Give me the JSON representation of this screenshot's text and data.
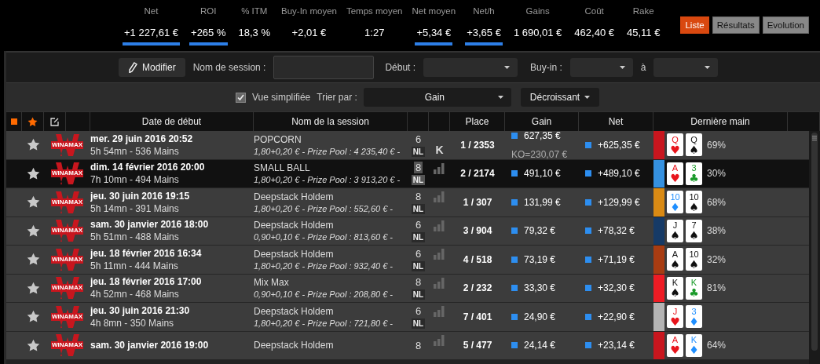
{
  "stats": [
    {
      "label": "Net",
      "value": "+1 227,61 €",
      "highlighted": true
    },
    {
      "label": "ROI",
      "value": "+265 %",
      "highlighted": true
    },
    {
      "label": "% ITM",
      "value": "18,3 %",
      "highlighted": false
    },
    {
      "label": "Buy-In moyen",
      "value": "+2,01 €",
      "highlighted": false
    },
    {
      "label": "Temps moyen",
      "value": "1:27",
      "highlighted": false
    },
    {
      "label": "Net moyen",
      "value": "+5,34 €",
      "highlighted": true
    },
    {
      "label": "Net/h",
      "value": "+3,65 €",
      "highlighted": true
    },
    {
      "label": "Gains",
      "value": "1 690,01 €",
      "highlighted": false
    },
    {
      "label": "Coût",
      "value": "462,40 €",
      "highlighted": false
    },
    {
      "label": "Rake",
      "value": "45,11 €",
      "highlighted": false
    }
  ],
  "views": [
    {
      "label": "Liste",
      "selected": true
    },
    {
      "label": "Résultats",
      "selected": false
    },
    {
      "label": "Evolution",
      "selected": false
    }
  ],
  "filters": {
    "edit_button": "Modifier",
    "session_label": "Nom de session :",
    "start_label": "Début :",
    "buyin_label": "Buy-in :",
    "to_label": "à"
  },
  "sort": {
    "simplified_label": "Vue simplifiée",
    "simplified_checked": true,
    "sort_label": "Trier par :",
    "sort_value": "Gain",
    "order": "Décroissant"
  },
  "table": {
    "columns": [
      "Date de début",
      "Nom de la session",
      "Place",
      "Gain",
      "Net",
      "Dernière main"
    ],
    "rows": [
      {
        "selected": false,
        "room": "WINAMAX",
        "date": "mer. 29 juin 2016 20:52",
        "duration": "5h 54mn - 536 Mains",
        "name": "POPCORN",
        "details": "1,80+0,20 € - Prize Pool : 4 235,40 € -",
        "seats": "6",
        "game": "NL",
        "kind": "knockout",
        "level_text": "K",
        "place": "1 / 2353",
        "gain": "627,35 €",
        "gain_note": "KO=230,07 €",
        "net": "+625,35 €",
        "color": "#c8161e",
        "cards": [
          {
            "rank": "Q",
            "suit": "♥",
            "color": "#e8141c"
          },
          {
            "rank": "Q",
            "suit": "♠",
            "color": "#111111"
          }
        ],
        "pct": "69%"
      },
      {
        "selected": true,
        "room": "WINAMAX",
        "date": "dim. 14 février 2016 20:00",
        "duration": "7h 10mn - 494 Mains",
        "name": "SMALL BALL",
        "details": "1,80+0,20 € - Prize Pool : 3 913,20 € -",
        "seats": "8",
        "game": "NL",
        "kind": "bars",
        "place": "2 / 2174",
        "gain": "491,10 €",
        "net": "+489,10 €",
        "color": "#3591e0",
        "cards": [
          {
            "rank": "A",
            "suit": "♥",
            "color": "#e8141c"
          },
          {
            "rank": "3",
            "suit": "♣",
            "color": "#1a9a2a"
          }
        ],
        "pct": "30%"
      },
      {
        "selected": false,
        "room": "WINAMAX",
        "date": "jeu. 30 juin 2016 19:15",
        "duration": "5h 14mn - 391 Mains",
        "name": "Deepstack Holdem",
        "details": "1,80+0,20 € - Prize Pool : 552,60 € -",
        "seats": "8",
        "game": "NL",
        "kind": "bars",
        "place": "1 / 307",
        "gain": "131,99 €",
        "net": "+129,99 €",
        "color": "#d98a14",
        "cards": [
          {
            "rank": "10",
            "suit": "♦",
            "color": "#1f8fff"
          },
          {
            "rank": "10",
            "suit": "♠",
            "color": "#111111"
          }
        ],
        "pct": "68%"
      },
      {
        "selected": false,
        "room": "WINAMAX",
        "date": "sam. 30 janvier 2016 18:00",
        "duration": "5h 51mn - 488 Mains",
        "name": "Deepstack Holdem",
        "details": "0,90+0,10 € - Prize Pool : 813,60 € -",
        "seats": "6",
        "game": "NL",
        "kind": "bars",
        "place": "3 / 904",
        "gain": "79,32 €",
        "net": "+78,32 €",
        "color": "#163a66",
        "cards": [
          {
            "rank": "J",
            "suit": "♠",
            "color": "#111111"
          },
          {
            "rank": "7",
            "suit": "♠",
            "color": "#111111"
          }
        ],
        "pct": "38%"
      },
      {
        "selected": false,
        "room": "WINAMAX",
        "date": "jeu. 18 février 2016 16:34",
        "duration": "5h 11mn - 444 Mains",
        "name": "Deepstack Holdem",
        "details": "1,80+0,20 € - Prize Pool : 932,40 € -",
        "seats": "6",
        "game": "NL",
        "kind": "bars",
        "place": "4 / 518",
        "gain": "73,19 €",
        "net": "+71,19 €",
        "color": "#a83c12",
        "cards": [
          {
            "rank": "A",
            "suit": "♠",
            "color": "#111111"
          },
          {
            "rank": "10",
            "suit": "♠",
            "color": "#111111"
          }
        ],
        "pct": "32%"
      },
      {
        "selected": false,
        "room": "WINAMAX",
        "date": "jeu. 18 février 2016 17:00",
        "duration": "4h 52mn - 468 Mains",
        "name": "Mix Max",
        "details": "0,90+0,10 € - Prize Pool : 208,80 € -",
        "seats": "8",
        "game": "NL",
        "kind": "bars",
        "place": "2 / 232",
        "gain": "33,30 €",
        "net": "+32,30 €",
        "color": "#ee1c24",
        "cards": [
          {
            "rank": "K",
            "suit": "♠",
            "color": "#111111"
          },
          {
            "rank": "K",
            "suit": "♣",
            "color": "#1a9a2a"
          }
        ],
        "pct": "81%"
      },
      {
        "selected": false,
        "room": "WINAMAX",
        "date": "jeu. 30 juin 2016 21:30",
        "duration": "4h 8mn - 350 Mains",
        "name": "Deepstack Holdem",
        "details": "1,80+0,20 € - Prize Pool : 721,80 € -",
        "seats": "6",
        "game": "NL",
        "kind": "bars",
        "place": "7 / 401",
        "gain": "24,90 €",
        "net": "+22,90 €",
        "color": "#b4b4b4",
        "cards": [
          {
            "rank": "J",
            "suit": "♥",
            "color": "#e8141c"
          },
          {
            "rank": "3",
            "suit": "♦",
            "color": "#1f8fff"
          }
        ]
      },
      {
        "selected": false,
        "room": "WINAMAX",
        "date": "sam. 30 janvier 2016 19:00",
        "name": "Deepstack Holdem",
        "seats": "8",
        "kind": "bars",
        "place": "5 / 477",
        "gain": "24,14 €",
        "net": "+23,14 €",
        "color": "#c8161e",
        "cards": [
          {
            "rank": "A",
            "suit": "♥",
            "color": "#e8141c"
          },
          {
            "rank": "K",
            "suit": "♦",
            "color": "#1f8fff"
          }
        ],
        "pct": "64%"
      }
    ]
  }
}
